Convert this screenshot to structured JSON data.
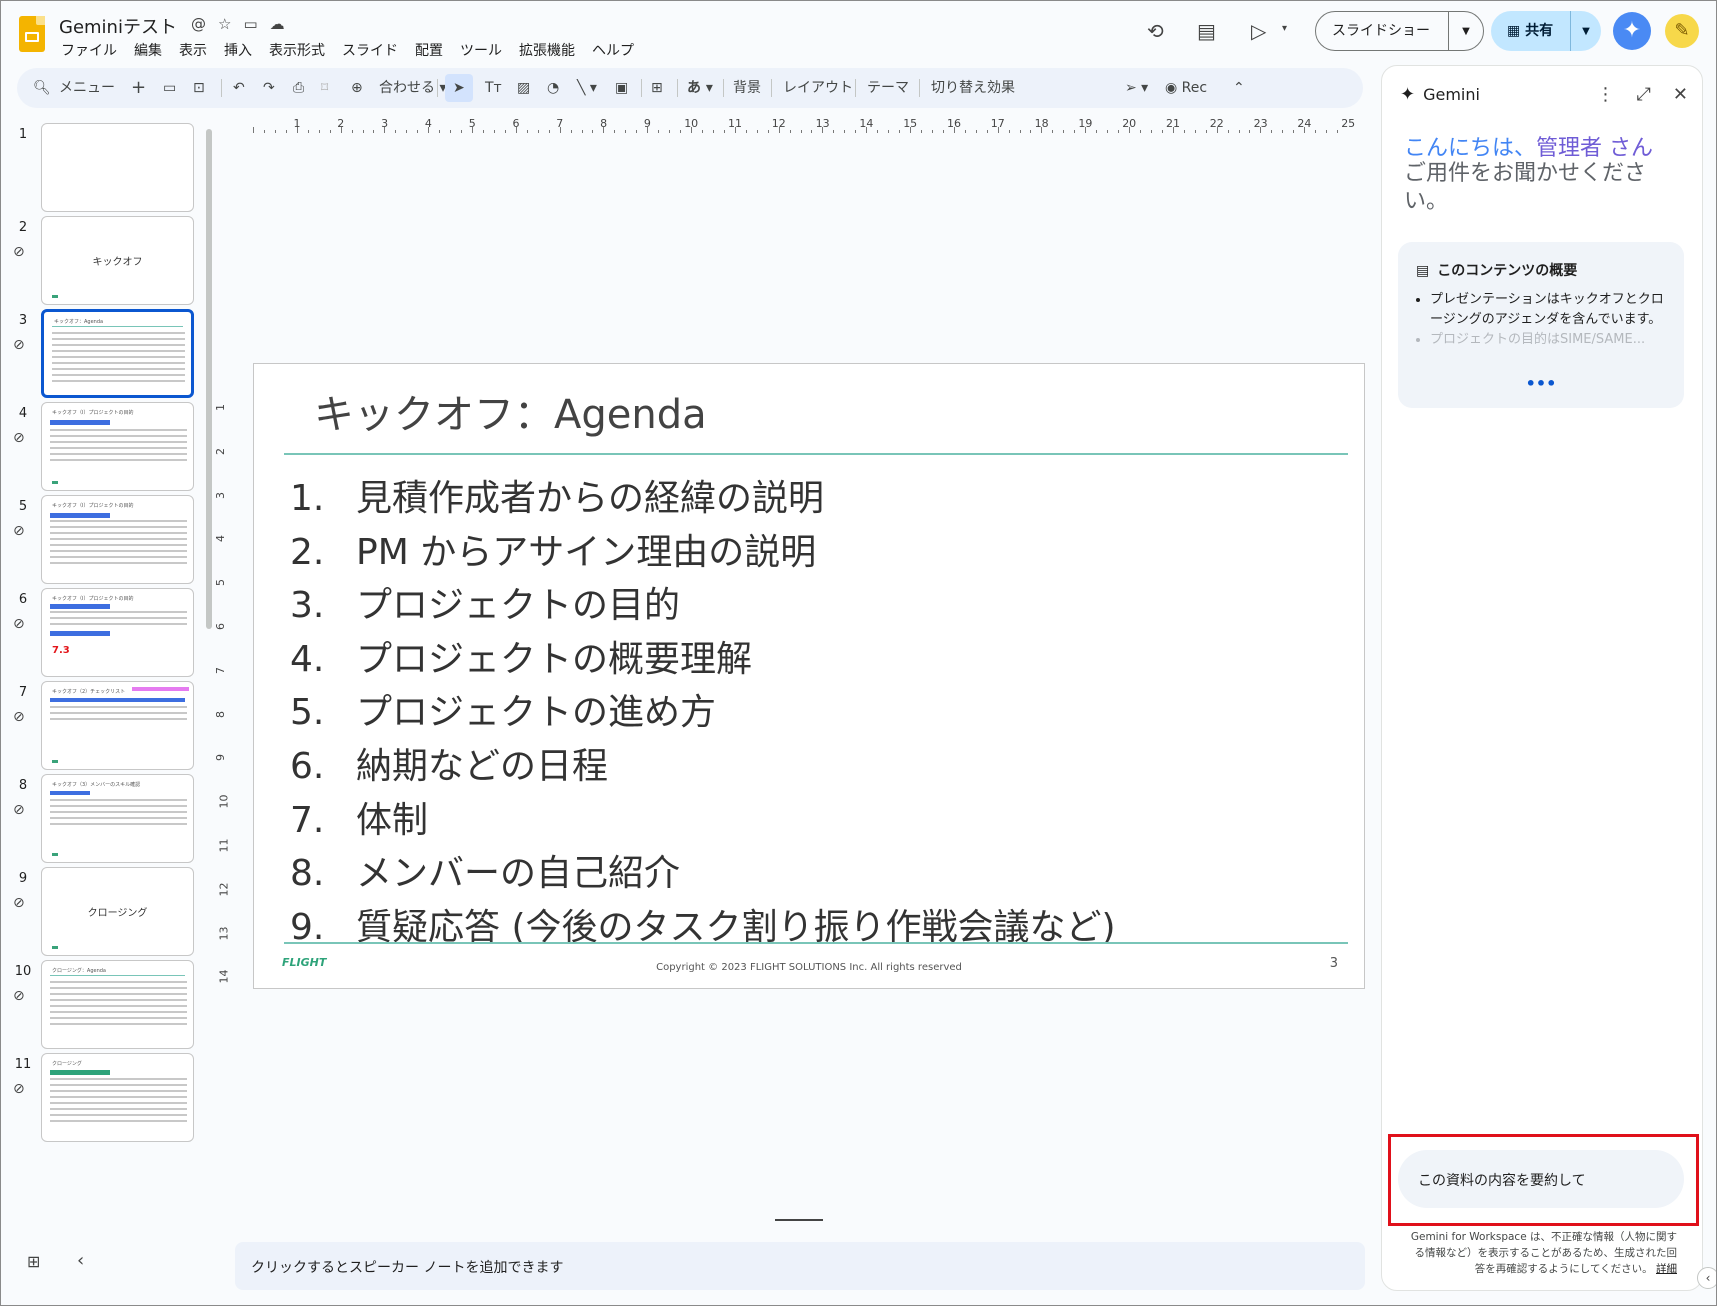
{
  "app": {
    "doc_title": "Geminiテスト",
    "menu": [
      "ファイル",
      "編集",
      "表示",
      "挿入",
      "表示形式",
      "スライド",
      "配置",
      "ツール",
      "拡張機能",
      "ヘルプ"
    ],
    "slideshow_label": "スライドショー",
    "share_label": "共有"
  },
  "toolbar": {
    "search_label": "メニュー",
    "zoom_label": "合わせる",
    "aa_label": "あ",
    "background_label": "背景",
    "layout_label": "レイアウト",
    "theme_label": "テーマ",
    "transition_label": "切り替え効果",
    "rec_label": "Rec"
  },
  "filmstrip": {
    "slides": [
      {
        "num": "1",
        "title": ""
      },
      {
        "num": "2",
        "title": "キックオフ"
      },
      {
        "num": "3",
        "title": "キックオフ：Agenda"
      },
      {
        "num": "4",
        "title": "キックオフ（I）プロジェクトの目的"
      },
      {
        "num": "5",
        "title": "キックオフ（I）プロジェクトの目的"
      },
      {
        "num": "6",
        "title": "キックオフ（I）プロジェクトの目的"
      },
      {
        "num": "7",
        "title": "キックオフ（2）チェックリスト"
      },
      {
        "num": "8",
        "title": "キックオフ（3）メンバーのスキル確認"
      },
      {
        "num": "9",
        "title": "クロージング"
      },
      {
        "num": "10",
        "title": "クロージング：Agenda"
      },
      {
        "num": "11",
        "title": "クロージング"
      }
    ],
    "thumb6_big": "7.3"
  },
  "ruler": {
    "h_numbers": [
      "1",
      "2",
      "3",
      "4",
      "5",
      "6",
      "7",
      "8",
      "9",
      "10",
      "11",
      "12",
      "13",
      "14",
      "15",
      "16",
      "17",
      "18",
      "19",
      "20",
      "21",
      "22",
      "23",
      "24",
      "25"
    ],
    "v_numbers": [
      "1",
      "2",
      "3",
      "4",
      "5",
      "6",
      "7",
      "8",
      "9",
      "10",
      "11",
      "12",
      "13",
      "14"
    ]
  },
  "slide": {
    "title": "キックオフ：Agenda",
    "items": [
      {
        "n": "1.",
        "text": "見積作成者からの経緯の説明"
      },
      {
        "n": "2.",
        "text": "PM からアサイン理由の説明"
      },
      {
        "n": "3.",
        "text": "プロジェクトの目的"
      },
      {
        "n": "4.",
        "text": "プロジェクトの概要理解"
      },
      {
        "n": "5.",
        "text": "プロジェクトの進め方"
      },
      {
        "n": "6.",
        "text": "納期などの日程"
      },
      {
        "n": "7.",
        "text": "体制"
      },
      {
        "n": "8.",
        "text": "メンバーの自己紹介"
      },
      {
        "n": "9.",
        "text": "質疑応答 (今後のタスク割り振り作戦会議など)"
      }
    ],
    "logo_text": "FLIGHT",
    "copyright": "Copyright ©  2023 FLIGHT SOLUTIONS Inc. All rights reserved",
    "page_number": "3"
  },
  "notes": {
    "placeholder": "クリックするとスピーカー ノートを追加できます"
  },
  "gemini": {
    "title": "Gemini",
    "greeting_hello": "こんにちは、",
    "greeting_name": "管理者 さん",
    "greeting_sub": "ご用件をお聞かせください。",
    "summary_title": "このコンテンツの概要",
    "summary_items": [
      "プレゼンテーションはキックオフとクロージングのアジェンダを含んでいます。",
      "プロジェクトの目的はSIME/SAME..."
    ],
    "input_text": "この資料の内容を要約して",
    "disclaimer": "Gemini for Workspace は、不正確な情報（人物に関する情報など）を表示することがあるため、生成された回答を再確認するようにしてください。",
    "disclaimer_link": "詳細"
  }
}
